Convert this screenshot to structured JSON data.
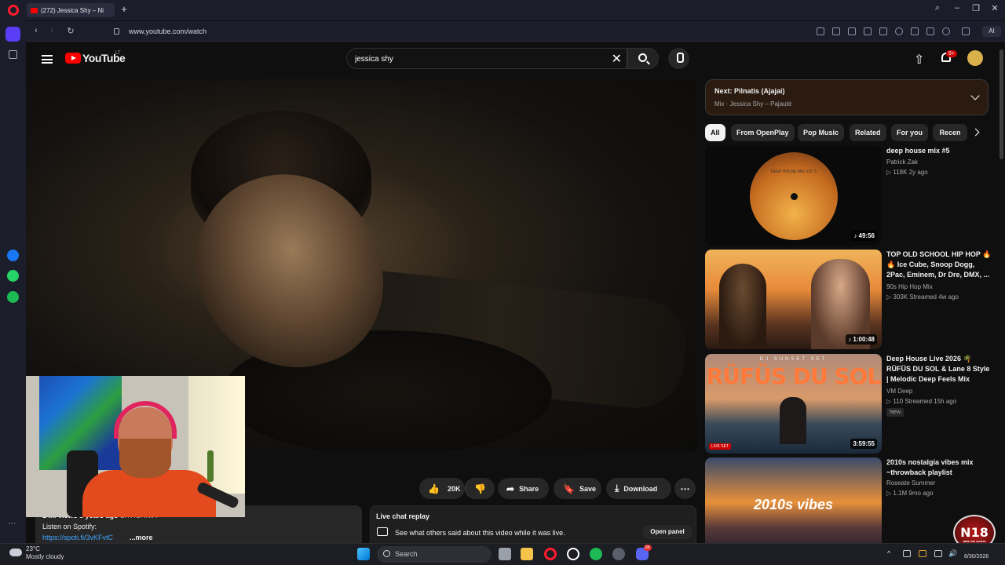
{
  "browser": {
    "tab_title": "(272) Jessica Shy – Ni",
    "new_tab": "+",
    "url": "www.youtube.com/watch",
    "ai_label": "AI"
  },
  "youtube": {
    "logo_text": "YouTube",
    "country_code": "LT",
    "search_value": "jessica shy",
    "notif_count": "9+",
    "actions": {
      "like_count": "20K",
      "share": "Share",
      "save": "Save",
      "download": "Download"
    },
    "description": {
      "views": "14M views  3 years ago",
      "location": "LITHUANIA",
      "line2": "Listen on Spotify:",
      "link": "https://spoti.fi/3vKFvtC",
      "more": "...more"
    },
    "chat": {
      "title": "Live chat replay",
      "text": "See what others said about this video while it was live.",
      "open_panel": "Open panel"
    },
    "up_next": {
      "title": "Next: Pilnatis (Ajajai)",
      "subtitle": "Mix · Jessica Shy – Pajautė"
    },
    "chips": [
      "All",
      "From OpenPlay",
      "Pop Music",
      "Related",
      "For you",
      "Recen"
    ],
    "videos": [
      {
        "title": "deep house mix #5",
        "channel": "Patrick Zak",
        "meta": "▷ 118K   2y ago",
        "duration": "♪ 49:56",
        "thumb_text": "DEEP HOUSE MIX VOL 5"
      },
      {
        "title": "TOP OLD SCHOOL HIP HOP 🔥 🔥 Ice Cube, Snoop Dogg, 2Pac, Eminem, Dr Dre, DMX, ...",
        "channel": "90s Hip Hop Mix",
        "meta": "▷ 303K   Streamed 4w ago",
        "duration": "♪ 1:00:48"
      },
      {
        "title": "Deep House Live 2026 🌴 RÜFÜS DU SOL & Lane 8 Style | Melodic Deep Feels Mix",
        "channel": "VM Deep",
        "meta": "▷ 110   Streamed 15h ago",
        "duration": "3:59:55",
        "badge": "New",
        "thumb_text": "RÜFÜS DU SOL",
        "thumb_sub": "DJ SUNSET SET",
        "live_label": "LIVE SET"
      },
      {
        "title": "2010s nostalgia vibes mix ~throwback playlist",
        "channel": "Roseate Summer",
        "meta": "▷ 1.1M   9mo ago",
        "thumb_text": "2010s vibes"
      }
    ]
  },
  "taskbar": {
    "temp": "23°C",
    "weather": "Mostly cloudy",
    "search": "Search",
    "date": "8/30/2026",
    "discord_badge": "64"
  },
  "overlay": {
    "logo": "N18",
    "logo_sub": "NEW TOP LIGHTS"
  },
  "colors": {
    "accent": "#ff0000",
    "link": "#3ea6ff",
    "opera": "#ff1b2d",
    "sidebar_active": "#5a3df5"
  }
}
